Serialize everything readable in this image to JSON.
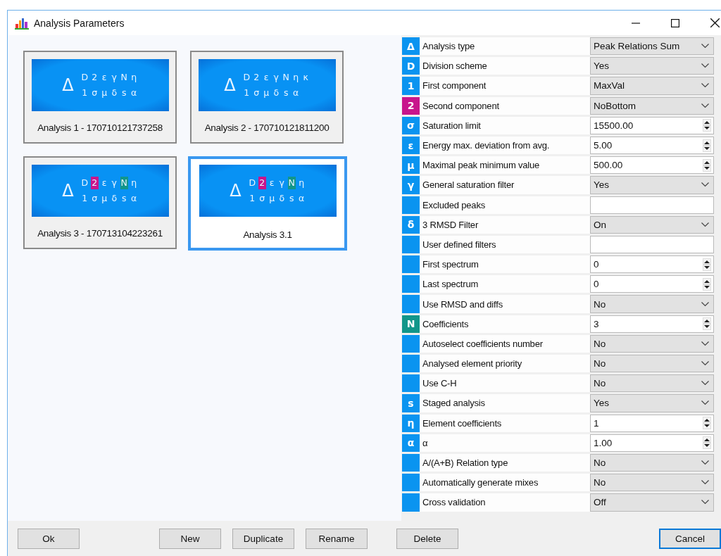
{
  "window": {
    "title": "Analysis Parameters"
  },
  "analyses": [
    {
      "label": "Analysis 1 - 170710121737258",
      "selected": false,
      "image": {
        "symbol": "Δ",
        "top": [
          {
            "text": "D"
          },
          {
            "text": "2"
          },
          {
            "text": "ε"
          },
          {
            "text": "γ"
          },
          {
            "text": "N"
          },
          {
            "text": "η"
          }
        ],
        "bottom": [
          {
            "text": "1"
          },
          {
            "text": "σ"
          },
          {
            "text": "μ"
          },
          {
            "text": "δ"
          },
          {
            "text": "s"
          },
          {
            "text": "α"
          }
        ]
      }
    },
    {
      "label": "Analysis 2 - 170710121811200",
      "selected": false,
      "image": {
        "symbol": "Δ",
        "top": [
          {
            "text": "D"
          },
          {
            "text": "2"
          },
          {
            "text": "ε"
          },
          {
            "text": "γ"
          },
          {
            "text": "N"
          },
          {
            "text": "η"
          },
          {
            "text": "κ"
          }
        ],
        "bottom": [
          {
            "text": "1"
          },
          {
            "text": "σ"
          },
          {
            "text": "μ"
          },
          {
            "text": "δ"
          },
          {
            "text": "s"
          },
          {
            "text": "α"
          }
        ]
      }
    },
    {
      "label": "Analysis 3 - 170713104223261",
      "selected": false,
      "image": {
        "symbol": "Δ",
        "top": [
          {
            "text": "D"
          },
          {
            "text": "2",
            "color": "#c8158c"
          },
          {
            "text": "ε"
          },
          {
            "text": "γ"
          },
          {
            "text": "N",
            "color": "#12968a"
          },
          {
            "text": "η"
          }
        ],
        "bottom": [
          {
            "text": "1"
          },
          {
            "text": "σ"
          },
          {
            "text": "μ"
          },
          {
            "text": "δ"
          },
          {
            "text": "s"
          },
          {
            "text": "α"
          }
        ]
      }
    },
    {
      "label": "Analysis 3.1",
      "selected": true,
      "image": {
        "symbol": "Δ",
        "top": [
          {
            "text": "D"
          },
          {
            "text": "2",
            "color": "#c8158c"
          },
          {
            "text": "ε"
          },
          {
            "text": "γ"
          },
          {
            "text": "N",
            "color": "#12968a"
          },
          {
            "text": "η"
          }
        ],
        "bottom": [
          {
            "text": "1"
          },
          {
            "text": "σ"
          },
          {
            "text": "μ"
          },
          {
            "text": "δ"
          },
          {
            "text": "s"
          },
          {
            "text": "α"
          }
        ]
      }
    }
  ],
  "parameters": [
    {
      "badge": "Δ",
      "color": "#0a94f0",
      "label": "Analysis type",
      "kind": "dropdown",
      "value": "Peak Relations Sum"
    },
    {
      "badge": "D",
      "color": "#0a94f0",
      "label": "Division scheme",
      "kind": "dropdown",
      "value": "Yes"
    },
    {
      "badge": "1",
      "color": "#0a94f0",
      "label": "First component",
      "kind": "dropdown",
      "value": "MaxVal"
    },
    {
      "badge": "2",
      "color": "#c8158c",
      "label": "Second component",
      "kind": "dropdown",
      "value": "NoBottom"
    },
    {
      "badge": "σ",
      "color": "#0a94f0",
      "label": "Saturation limit",
      "kind": "spin",
      "value": "15500.00"
    },
    {
      "badge": "ε",
      "color": "#0a94f0",
      "label": "Energy max. deviation from avg.",
      "kind": "spin",
      "value": "5.00"
    },
    {
      "badge": "μ",
      "color": "#0a94f0",
      "label": "Maximal peak minimum value",
      "kind": "spin",
      "value": "500.00"
    },
    {
      "badge": "γ",
      "color": "#0a94f0",
      "label": "General saturation filter",
      "kind": "dropdown",
      "value": "Yes"
    },
    {
      "color": "#0a94f0",
      "label": "Excluded peaks",
      "kind": "text"
    },
    {
      "badge": "δ",
      "color": "#0a94f0",
      "label": "3 RMSD Filter",
      "kind": "dropdown",
      "value": "On"
    },
    {
      "color": "#0a94f0",
      "label": "User defined filters",
      "kind": "text"
    },
    {
      "color": "#0a94f0",
      "label": "First spectrum",
      "kind": "spin",
      "value": "0"
    },
    {
      "color": "#0a94f0",
      "label": "Last spectrum",
      "kind": "spin",
      "value": "0"
    },
    {
      "color": "#0a94f0",
      "label": "Use RMSD and diffs",
      "kind": "dropdown",
      "value": "No"
    },
    {
      "badge": "N",
      "color": "#12968a",
      "label": "Coefficients",
      "kind": "spin",
      "value": "3"
    },
    {
      "color": "#0a94f0",
      "label": "Autoselect coefficients number",
      "kind": "dropdown",
      "value": "No"
    },
    {
      "color": "#0a94f0",
      "label": "Analysed element priority",
      "kind": "dropdown",
      "value": "No"
    },
    {
      "color": "#0a94f0",
      "label": "Use C-H",
      "kind": "dropdown",
      "value": "No"
    },
    {
      "badge": "s",
      "color": "#0a94f0",
      "label": "Staged analysis",
      "kind": "dropdown",
      "value": "Yes"
    },
    {
      "badge": "η",
      "color": "#0a94f0",
      "label": "Element coefficients",
      "kind": "spin",
      "value": "1"
    },
    {
      "badge": "α",
      "color": "#0a94f0",
      "label": "α",
      "kind": "spin",
      "value": "1.00"
    },
    {
      "color": "#0a94f0",
      "label": "A/(A+B) Relation type",
      "kind": "dropdown",
      "value": "No"
    },
    {
      "color": "#0a94f0",
      "label": "Automatically generate mixes",
      "kind": "dropdown",
      "value": "No"
    },
    {
      "color": "#0a94f0",
      "label": "Cross validation",
      "kind": "dropdown",
      "value": "Off"
    }
  ],
  "button_groups": [
    {
      "buttons": [
        {
          "label": "Ok",
          "focused": false
        }
      ]
    },
    {
      "buttons": [
        {
          "label": "New",
          "focused": false
        },
        {
          "label": "Duplicate",
          "focused": false
        },
        {
          "label": "Rename",
          "focused": false
        }
      ]
    },
    {
      "buttons": [
        {
          "label": "Delete",
          "focused": false
        }
      ]
    },
    {
      "buttons": [
        {
          "label": "Cancel",
          "focused": true
        }
      ]
    }
  ]
}
